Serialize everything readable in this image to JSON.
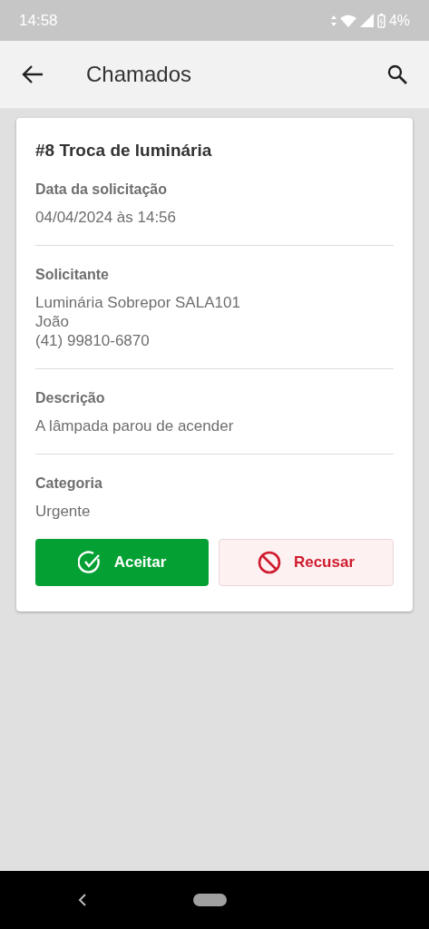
{
  "status_bar": {
    "time": "14:58",
    "battery": "4%"
  },
  "app_bar": {
    "title": "Chamados"
  },
  "card": {
    "title": "#8 Troca de luminária",
    "sections": [
      {
        "label": "Data da solicitação",
        "lines": [
          "04/04/2024 às 14:56"
        ]
      },
      {
        "label": "Solicitante",
        "lines": [
          "Luminária Sobrepor SALA101",
          "João",
          "(41) 99810-6870"
        ]
      },
      {
        "label": "Descrição",
        "lines": [
          "A lâmpada parou de acender"
        ]
      },
      {
        "label": "Categoria",
        "lines": [
          "Urgente"
        ]
      }
    ],
    "buttons": [
      {
        "kind": "accept",
        "label": "Aceitar"
      },
      {
        "kind": "decline",
        "label": "Recusar"
      }
    ]
  }
}
